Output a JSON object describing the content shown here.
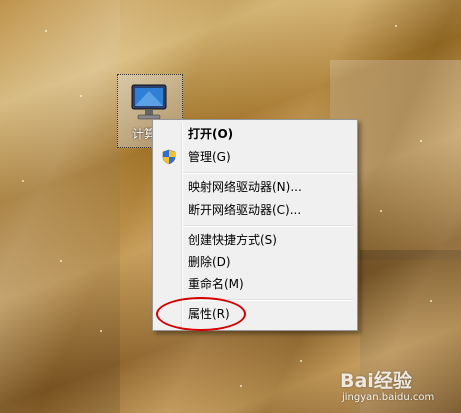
{
  "desktop": {
    "icon": {
      "label": "计算机",
      "icon": "computer-monitor-icon"
    }
  },
  "context_menu": {
    "items": [
      {
        "label": "打开(O)",
        "bold": true
      },
      {
        "label": "管理(G)",
        "icon": "uac-shield-icon"
      },
      {
        "label": "映射网络驱动器(N)..."
      },
      {
        "label": "断开网络驱动器(C)..."
      },
      {
        "label": "创建快捷方式(S)"
      },
      {
        "label": "删除(D)"
      },
      {
        "label": "重命名(M)"
      },
      {
        "label": "属性(R)",
        "highlighted": true
      }
    ]
  },
  "annotation": {
    "color": "#d40000"
  },
  "watermark": {
    "logo": "Bai经验",
    "url": "jingyan.baidu.com"
  }
}
